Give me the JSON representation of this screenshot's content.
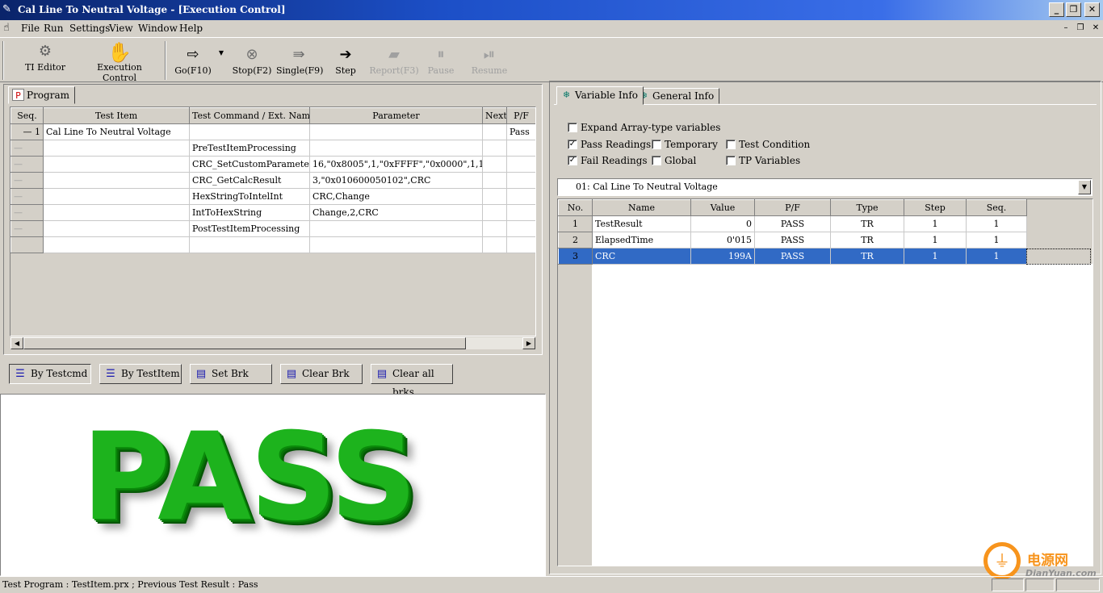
{
  "window": {
    "title": "Cal Line To Neutral Voltage - [Execution Control]"
  },
  "menu": [
    "File",
    "Run",
    "Settings",
    "View",
    "Window",
    "Help"
  ],
  "toolbar": {
    "ti_editor": "TI Editor",
    "execution_control": "Execution Control",
    "go": "Go(F10)",
    "stop": "Stop(F2)",
    "single": "Single(F9)",
    "step": "Step",
    "report": "Report(F3)",
    "pause": "Pause",
    "resume": "Resume"
  },
  "program": {
    "tab": "Program",
    "columns": [
      "Seq.",
      "Test Item",
      "Test Command /  Ext. Name",
      "Parameter",
      "Next",
      "P/F"
    ],
    "rows": [
      [
        "1",
        "Cal Line To Neutral Voltage",
        "",
        "",
        "",
        "Pass"
      ],
      [
        "",
        "",
        "PreTestItemProcessing",
        "",
        "",
        ""
      ],
      [
        "",
        "",
        "CRC_SetCustomParameter",
        "16,\"0x8005\",1,\"0xFFFF\",\"0x0000\",1,1",
        "",
        ""
      ],
      [
        "",
        "",
        "CRC_GetCalcResult",
        "3,\"0x010600050102\",CRC",
        "",
        ""
      ],
      [
        "",
        "",
        "HexStringToIntelInt",
        "CRC,Change",
        "",
        ""
      ],
      [
        "",
        "",
        "IntToHexString",
        "Change,2,CRC",
        "",
        ""
      ],
      [
        "",
        "",
        "PostTestItemProcessing",
        "",
        "",
        ""
      ],
      [
        "",
        "",
        "",
        "",
        "",
        ""
      ]
    ]
  },
  "buttons": {
    "by_testcmd": "By Testcmd",
    "by_testitem": "By TestItem",
    "set_brk": "Set Brk",
    "clear_brk": "Clear Brk",
    "clear_all": "Clear all brks"
  },
  "result": {
    "text": "PASS",
    "color": "#1db31d"
  },
  "right": {
    "tab_variable": "Variable Info",
    "tab_general": "General Info",
    "checks": {
      "expand": {
        "label": "Expand Array-type variables",
        "checked": false
      },
      "pass": {
        "label": "Pass Readings",
        "checked": true
      },
      "temporary": {
        "label": "Temporary",
        "checked": false
      },
      "test_condition": {
        "label": "Test Condition",
        "checked": false
      },
      "fail": {
        "label": "Fail Readings",
        "checked": true
      },
      "global": {
        "label": "Global",
        "checked": false
      },
      "tp": {
        "label": "TP Variables",
        "checked": false
      }
    },
    "select": "01: Cal Line To Neutral Voltage",
    "columns": [
      "No.",
      "Name",
      "Value",
      "P/F",
      "Type",
      "Step",
      "Seq."
    ],
    "rows": [
      [
        "1",
        "TestResult",
        "0",
        "PASS",
        "TR",
        "1",
        "1"
      ],
      [
        "2",
        "ElapsedTime",
        "0'015",
        "PASS",
        "TR",
        "1",
        "1"
      ],
      [
        "3",
        "CRC",
        "199A",
        "PASS",
        "TR",
        "1",
        "1"
      ]
    ]
  },
  "status": "Test Program : TestItem.prx ; Previous Test Result : Pass",
  "watermark": {
    "cn": "电源网",
    "en": "DianYuan.com"
  }
}
